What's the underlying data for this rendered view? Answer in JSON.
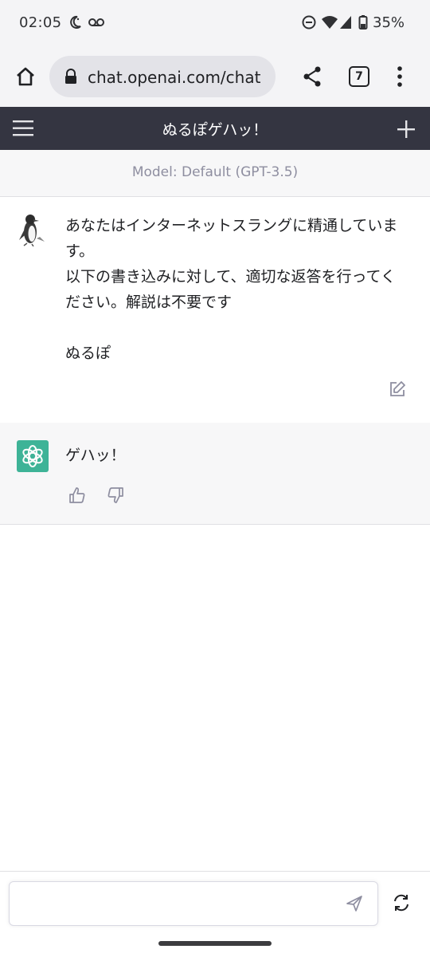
{
  "status_bar": {
    "time": "02:05",
    "battery_percent": "35%",
    "icons": [
      "moon-icon",
      "voicemail-icon",
      "dnd-icon",
      "wifi-icon",
      "signal-icon",
      "battery-icon"
    ]
  },
  "browser": {
    "url": "chat.openai.com/chat",
    "tab_count": "7",
    "icons": [
      "home-icon",
      "lock-icon",
      "share-icon",
      "tabs-icon",
      "more-icon"
    ]
  },
  "chat_header": {
    "title": "ぬるぽゲハッ！",
    "icons": [
      "hamburger-menu-icon",
      "plus-icon"
    ]
  },
  "model_banner": {
    "text": "Model: Default (GPT-3.5)"
  },
  "messages": [
    {
      "role": "user",
      "lines": [
        "あなたはインターネットスラングに精通しています。",
        "以下の書き込みに対して、適切な返答を行ってください。解説は不要です",
        "",
        "ぬるぽ"
      ],
      "icons": [
        "penguin-avatar-icon",
        "edit-icon"
      ]
    },
    {
      "role": "assistant",
      "text": "ゲハッ！",
      "icons": [
        "openai-logo-icon",
        "thumbs-up-icon",
        "thumbs-down-icon"
      ]
    }
  ],
  "composer": {
    "placeholder": "",
    "icons": [
      "send-icon",
      "regenerate-icon"
    ]
  },
  "colors": {
    "header_bg": "#343541",
    "banner_bg": "#f7f7f8",
    "assistant_avatar": "#10a37f",
    "browser_chrome": "#f4f4f6"
  }
}
